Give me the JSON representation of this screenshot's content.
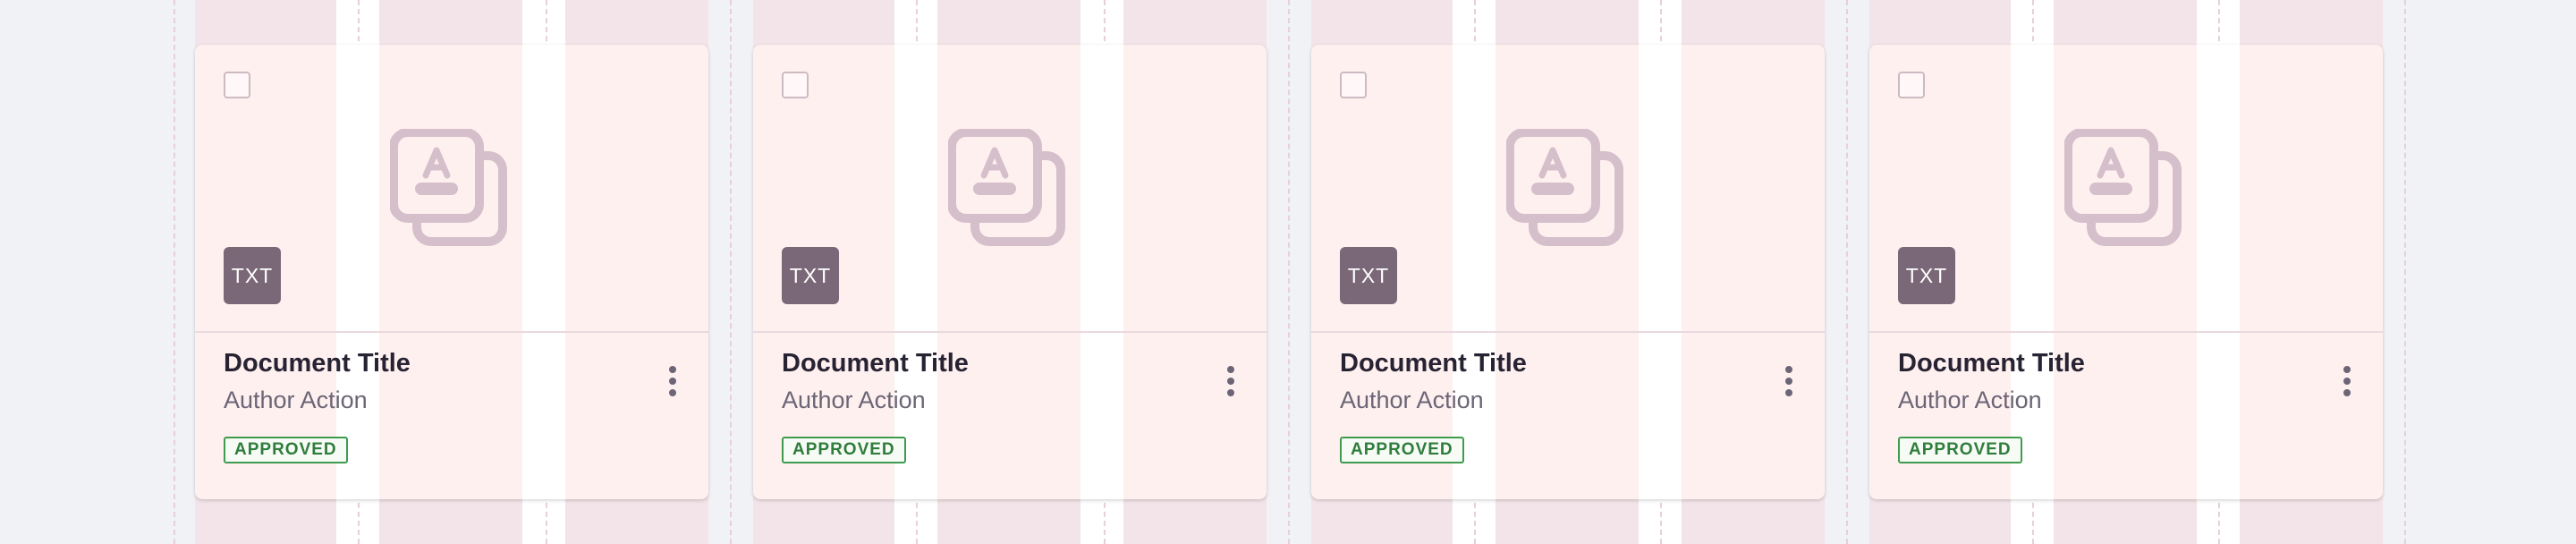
{
  "colors": {
    "page_background": "#f1f2f5",
    "card_background": "#fff0f0",
    "icon_color": "#d4bfcb",
    "badge_background": "#7a6878",
    "status_color": "#3f9c4e"
  },
  "cards": [
    {
      "file_type": "TXT",
      "title": "Document Title",
      "subtitle": "Author Action",
      "status": "APPROVED",
      "file_icon": "document-copy-icon",
      "menu_icon": "more-vertical-icon"
    },
    {
      "file_type": "TXT",
      "title": "Document Title",
      "subtitle": "Author Action",
      "status": "APPROVED",
      "file_icon": "document-copy-icon",
      "menu_icon": "more-vertical-icon"
    },
    {
      "file_type": "TXT",
      "title": "Document Title",
      "subtitle": "Author Action",
      "status": "APPROVED",
      "file_icon": "document-copy-icon",
      "menu_icon": "more-vertical-icon"
    },
    {
      "file_type": "TXT",
      "title": "Document Title",
      "subtitle": "Author Action",
      "status": "APPROVED",
      "file_icon": "document-copy-icon",
      "menu_icon": "more-vertical-icon"
    }
  ]
}
